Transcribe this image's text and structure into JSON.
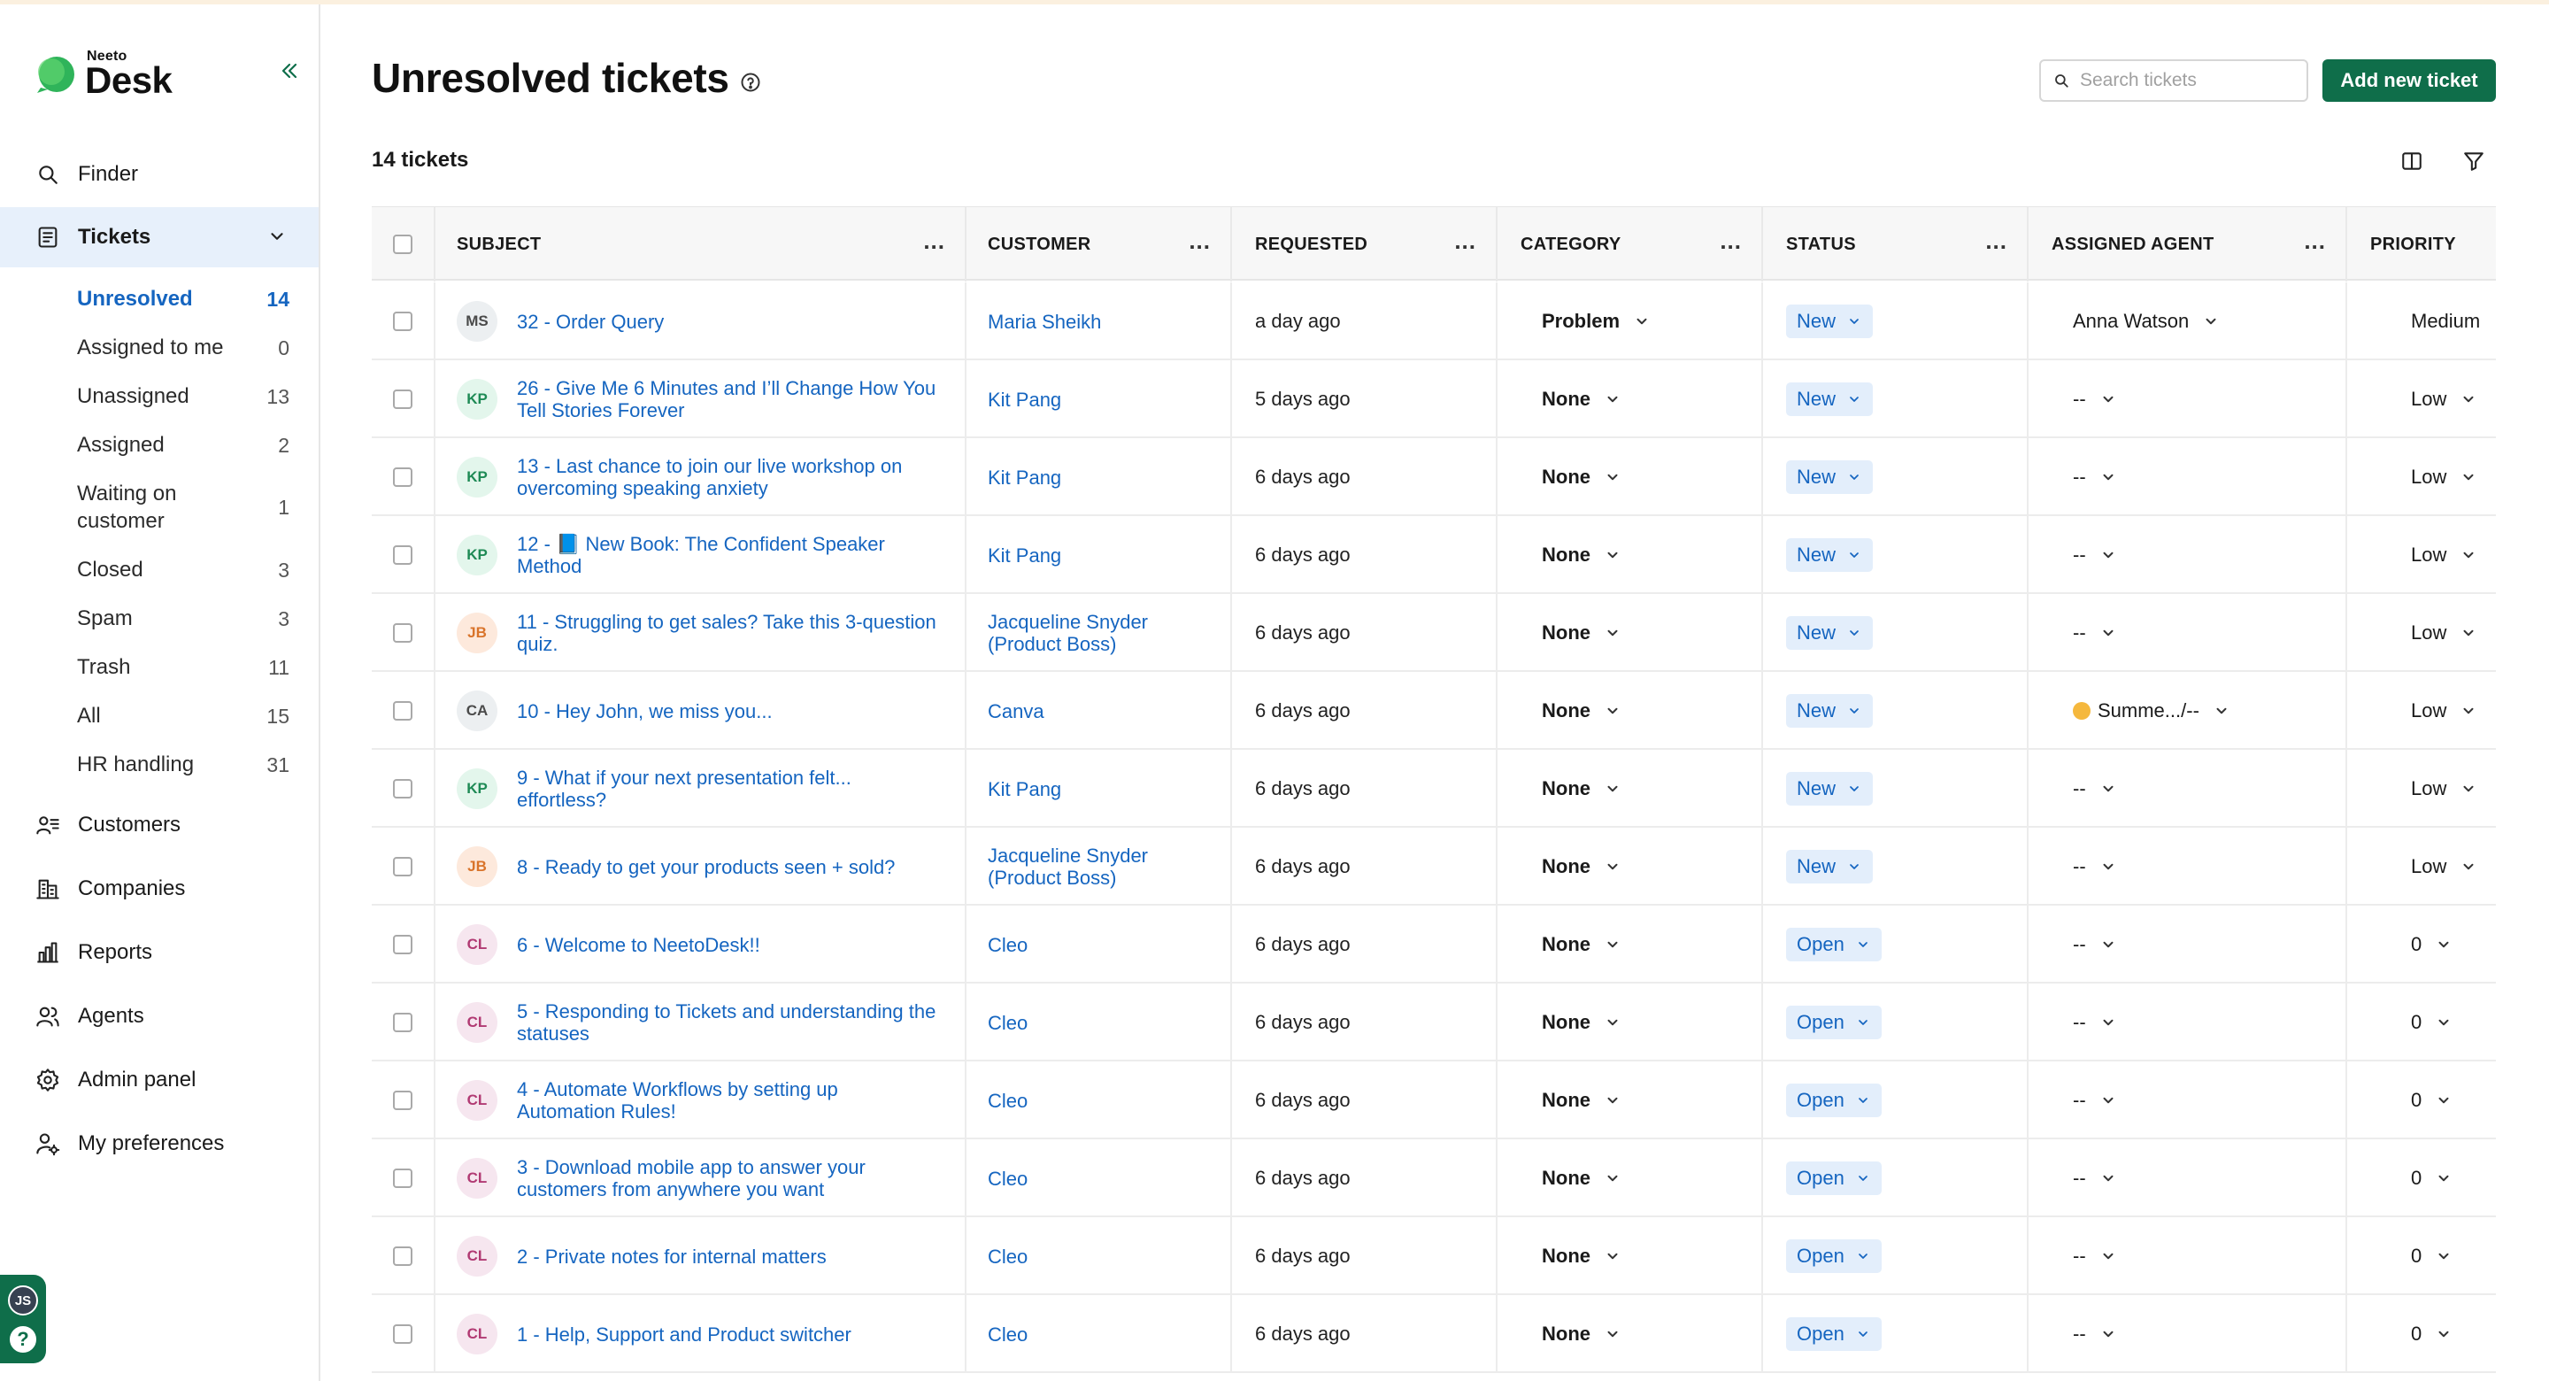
{
  "brand": {
    "small": "Neeto",
    "name": "Desk"
  },
  "sidebar": {
    "finder": "Finder",
    "tickets": "Tickets",
    "sub_items": [
      {
        "label": "Unresolved",
        "count": "14",
        "active": true
      },
      {
        "label": "Assigned to me",
        "count": "0"
      },
      {
        "label": "Unassigned",
        "count": "13"
      },
      {
        "label": "Assigned",
        "count": "2"
      },
      {
        "label": "Waiting on customer",
        "count": "1"
      },
      {
        "label": "Closed",
        "count": "3"
      },
      {
        "label": "Spam",
        "count": "3"
      },
      {
        "label": "Trash",
        "count": "11"
      },
      {
        "label": "All",
        "count": "15"
      },
      {
        "label": "HR handling",
        "count": "31"
      }
    ],
    "customers": "Customers",
    "companies": "Companies",
    "reports": "Reports",
    "agents": "Agents",
    "admin_panel": "Admin panel",
    "preferences": "My preferences",
    "user_initials": "JS",
    "help_glyph": "?"
  },
  "header": {
    "title": "Unresolved tickets",
    "search_placeholder": "Search tickets",
    "add_button": "Add new ticket",
    "count_label": "14 tickets"
  },
  "columns": {
    "subject": "SUBJECT",
    "customer": "CUSTOMER",
    "requested": "REQUESTED",
    "category": "CATEGORY",
    "status": "STATUS",
    "agent": "ASSIGNED AGENT",
    "priority": "PRIORITY",
    "menu_glyph": "..."
  },
  "colors": {
    "accent": "#0f6e4a",
    "link": "#1565c0",
    "status_bg": "#e3eefb"
  },
  "rows": [
    {
      "initials": "MS",
      "subject_l1": "32 - Order Query",
      "subject_l2": "",
      "customer_l1": "Maria Sheikh",
      "customer_l2": "",
      "requested": "a day ago",
      "category": "Problem",
      "status": "New",
      "agent": "Anna Watson",
      "priority": "Medium"
    },
    {
      "initials": "KP",
      "subject_l1": "26 - Give Me 6 Minutes and I’ll Change How You",
      "subject_l2": "Tell Stories Forever",
      "customer_l1": "Kit Pang",
      "customer_l2": "",
      "requested": "5 days ago",
      "category": "None",
      "status": "New",
      "agent": "--",
      "priority": "Low"
    },
    {
      "initials": "KP",
      "subject_l1": "13 - Last chance to join our live workshop on",
      "subject_l2": "overcoming speaking anxiety",
      "customer_l1": "Kit Pang",
      "customer_l2": "",
      "requested": "6 days ago",
      "category": "None",
      "status": "New",
      "agent": "--",
      "priority": "Low"
    },
    {
      "initials": "KP",
      "subject_l1": "12 - 📘 New Book: The Confident Speaker",
      "subject_l2": "Method",
      "customer_l1": "Kit Pang",
      "customer_l2": "",
      "requested": "6 days ago",
      "category": "None",
      "status": "New",
      "agent": "--",
      "priority": "Low"
    },
    {
      "initials": "JB",
      "subject_l1": "11 - Struggling to get sales? Take this 3-question",
      "subject_l2": "quiz.",
      "customer_l1": "Jacqueline Snyder",
      "customer_l2": "(Product Boss)",
      "requested": "6 days ago",
      "category": "None",
      "status": "New",
      "agent": "--",
      "priority": "Low"
    },
    {
      "initials": "CA",
      "subject_l1": "10 - Hey John, we miss you...",
      "subject_l2": "",
      "customer_l1": "Canva",
      "customer_l2": "",
      "requested": "6 days ago",
      "category": "None",
      "status": "New",
      "agent": "Summe.../--",
      "priority": "Low"
    },
    {
      "initials": "KP",
      "subject_l1": "9 - What if your next presentation felt...",
      "subject_l2": "effortless?",
      "customer_l1": "Kit Pang",
      "customer_l2": "",
      "requested": "6 days ago",
      "category": "None",
      "status": "New",
      "agent": "--",
      "priority": "Low"
    },
    {
      "initials": "JB",
      "subject_l1": "8 - Ready to get your products seen + sold?",
      "subject_l2": "",
      "customer_l1": "Jacqueline Snyder",
      "customer_l2": "(Product Boss)",
      "requested": "6 days ago",
      "category": "None",
      "status": "New",
      "agent": "--",
      "priority": "Low"
    },
    {
      "initials": "CL",
      "subject_l1": "6 - Welcome to NeetoDesk!!",
      "subject_l2": "",
      "customer_l1": "Cleo",
      "customer_l2": "",
      "requested": "6 days ago",
      "category": "None",
      "status": "Open",
      "agent": "--",
      "priority": "0"
    },
    {
      "initials": "CL",
      "subject_l1": "5 - Responding to Tickets and understanding the",
      "subject_l2": "statuses",
      "customer_l1": "Cleo",
      "customer_l2": "",
      "requested": "6 days ago",
      "category": "None",
      "status": "Open",
      "agent": "--",
      "priority": "0"
    },
    {
      "initials": "CL",
      "subject_l1": "4 - Automate Workflows by setting up",
      "subject_l2": "Automation Rules!",
      "customer_l1": "Cleo",
      "customer_l2": "",
      "requested": "6 days ago",
      "category": "None",
      "status": "Open",
      "agent": "--",
      "priority": "0"
    },
    {
      "initials": "CL",
      "subject_l1": "3 - Download mobile app to answer your",
      "subject_l2": "customers from anywhere you want",
      "customer_l1": "Cleo",
      "customer_l2": "",
      "requested": "6 days ago",
      "category": "None",
      "status": "Open",
      "agent": "--",
      "priority": "0"
    },
    {
      "initials": "CL",
      "subject_l1": "2 - Private notes for internal matters",
      "subject_l2": "",
      "customer_l1": "Cleo",
      "customer_l2": "",
      "requested": "6 days ago",
      "category": "None",
      "status": "Open",
      "agent": "--",
      "priority": "0"
    },
    {
      "initials": "CL",
      "subject_l1": "1 - Help, Support and Product switcher",
      "subject_l2": "",
      "customer_l1": "Cleo",
      "customer_l2": "",
      "requested": "6 days ago",
      "category": "None",
      "status": "Open",
      "agent": "--",
      "priority": "0"
    }
  ]
}
